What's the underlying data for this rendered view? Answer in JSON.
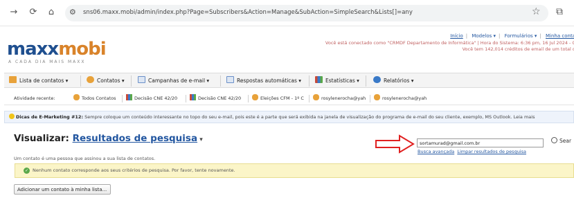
{
  "browser": {
    "url": "sns06.maxx.mobi/admin/index.php?Page=Subscribers&Action=Manage&SubAction=SimpleSearch&Lists[]=any"
  },
  "header": {
    "logo_main": "maxx",
    "logo_accent": "mobi",
    "tagline": "A CADA DIA MAIS MAXX",
    "links": [
      "Início",
      "Modelos ▾",
      "Formulários ▾",
      "Minha conta"
    ],
    "status_line1": "Você está conectado como \"CRMDF Departamento de Informática\" | Hora do Sistema: 6:36 pm, 16 Jul 2024 - C",
    "status_line2": "Você tem 142,014 créditos de email de um total d"
  },
  "menu": {
    "items": [
      {
        "label": "Lista de contatos ▾",
        "icon": "list-icon",
        "color": "#e8a23a"
      },
      {
        "label": "Contatos ▾",
        "icon": "contacts-icon",
        "color": "#e8a23a"
      },
      {
        "label": "Campanhas de e-mail ▾",
        "icon": "email-icon",
        "color": "#6a8fc8"
      },
      {
        "label": "Respostas automáticas ▾",
        "icon": "autoresponder-icon",
        "color": "#6a8fc8"
      },
      {
        "label": "Estatísticas ▾",
        "icon": "stats-icon",
        "color": "#c84a3a"
      },
      {
        "label": "Relatórios ▾",
        "icon": "reports-icon",
        "color": "#3a7ac8"
      }
    ]
  },
  "recent": {
    "label": "Atividade recente:",
    "items": [
      {
        "label": "Todos Contatos",
        "icon": "contacts-icon"
      },
      {
        "label": "Decisão CNE 42/20",
        "icon": "stats-icon"
      },
      {
        "label": "Decisão CNE 42/20",
        "icon": "stats-icon"
      },
      {
        "label": "Eleições CFM - 1º C",
        "icon": "contacts-icon"
      },
      {
        "label": "rosylenerocha@yah",
        "icon": "contacts-icon"
      },
      {
        "label": "rosylenerocha@yah",
        "icon": "contacts-icon"
      }
    ]
  },
  "tip": {
    "bold": "Dicas de E-Marketing #12:",
    "text": " Sempre coloque um conteúdo interessante no topo do seu e-mail, pois este é a parte que será exibida na janela de visualização do programa de e-mail do seu cliente, exemplo, MS Outlook. Leia mais"
  },
  "page": {
    "title_prefix": "Visualizar: ",
    "title_link": "Resultados de pesquisa",
    "title_caret": " ▾",
    "description": "Um contato é uma pessoa que assinou a sua lista de contatos."
  },
  "search": {
    "value": "sortamurad@gmail.com.br",
    "advanced_link": "Busca avançada",
    "clear_link": "Limpar resultados de pesquisa",
    "button": "Sear"
  },
  "notice": {
    "text": "Nenhum contato corresponde aos seus critérios de pesquisa. Por favor, tente novamente."
  },
  "actions": {
    "add_contact": "Adicionar um contato à minha lista..."
  },
  "colors": {
    "link": "#2256a0",
    "arrow": "#e02020",
    "notice_bg": "#fbf5c8"
  }
}
